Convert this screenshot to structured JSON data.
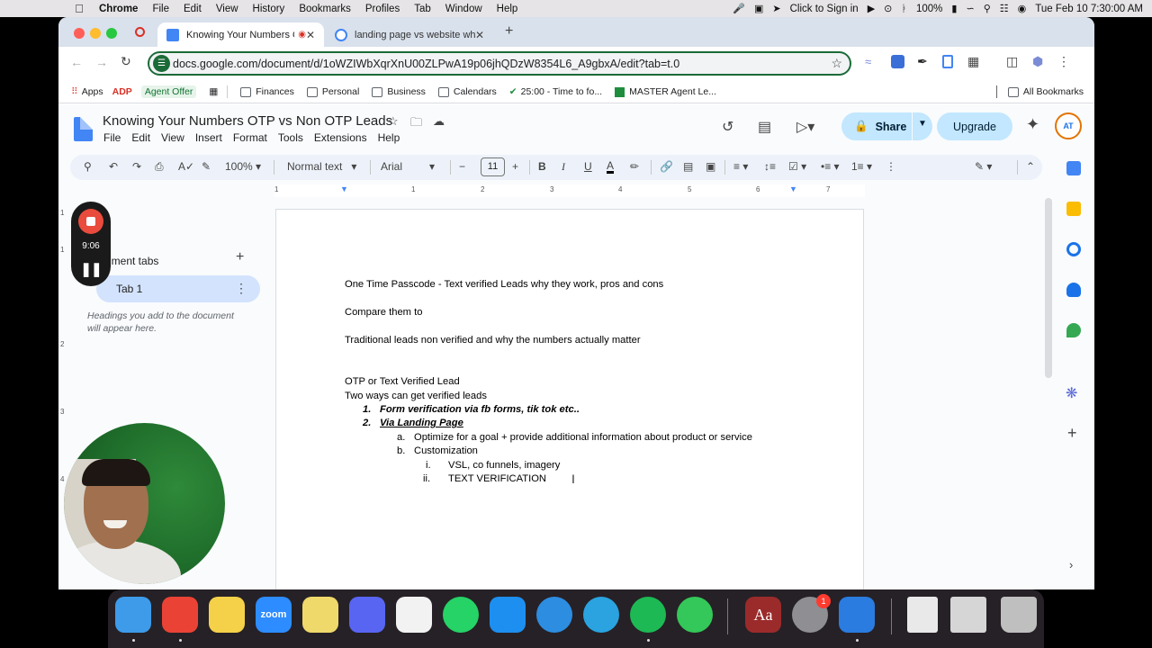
{
  "menubar": {
    "app": "Chrome",
    "items": [
      "File",
      "Edit",
      "View",
      "History",
      "Bookmarks",
      "Profiles",
      "Tab",
      "Window",
      "Help"
    ],
    "sign_in": "Click to Sign in",
    "battery": "100%",
    "clock": "Tue Feb 10  7:30:00 AM"
  },
  "browser": {
    "tabs": [
      {
        "title": "Knowing Your Numbers O",
        "active": true
      },
      {
        "title": "landing page vs website what",
        "active": false
      }
    ],
    "url": "docs.google.com/document/d/1oWZIWbXqrXnU00ZLPwA19p06jhQDzW8354L6_A9gbxA/edit?tab=t.0",
    "bookmarks": [
      "Apps",
      "ADP",
      "Agent Offer",
      "Finances",
      "Personal",
      "Business",
      "Calendars",
      "25:00 - Time to fo...",
      "MASTER Agent Le..."
    ],
    "all_bookmarks": "All Bookmarks"
  },
  "docs": {
    "title": "Knowing Your Numbers OTP vs Non OTP Leads",
    "menu": [
      "File",
      "Edit",
      "View",
      "Insert",
      "Format",
      "Tools",
      "Extensions",
      "Help"
    ],
    "share_label": "Share",
    "upgrade_label": "Upgrade",
    "avatar_initials": "AT",
    "zoom": "100%",
    "style": "Normal text",
    "font": "Arial",
    "font_size": "11",
    "ruler_numbers": [
      "1",
      "1",
      "2",
      "3",
      "4",
      "5",
      "6",
      "7"
    ],
    "left_ruler_numbers": [
      "1",
      "1",
      "2",
      "3",
      "4"
    ],
    "sidebar": {
      "doc_tabs_label": "ument tabs",
      "add": "+",
      "tab_label": "Tab 1",
      "hint": "Headings you add to the document will appear here."
    },
    "content": {
      "line1": "One Time Passcode - Text verified Leads why they work, pros and cons",
      "line2": "Compare them to",
      "line3": "Traditional leads non verified and why the numbers actually matter",
      "line4": "OTP or Text Verified Lead",
      "line5": "Two ways can get verified leads",
      "list": [
        {
          "marker": "1.",
          "text": "Form verification via fb forms, tik tok etc.."
        },
        {
          "marker": "2.",
          "text": "Via Landing Page"
        }
      ],
      "sublist": [
        {
          "marker": "a.",
          "text": "Optimize for a goal + provide additional information about product or service"
        },
        {
          "marker": "b.",
          "text": "Customization"
        }
      ],
      "subsublist": [
        {
          "marker": "i.",
          "text": "VSL, co funnels, imagery"
        },
        {
          "marker": "ii.",
          "text": "TEXT VERIFICATION"
        }
      ]
    }
  },
  "recorder": {
    "time": "9:06"
  },
  "dock": {
    "badge": "1",
    "apps": [
      {
        "name": "finder",
        "label": "",
        "color": "#3d9be9"
      },
      {
        "name": "chrome",
        "label": "",
        "color": "#ea4335"
      },
      {
        "name": "notes",
        "label": "",
        "color": "#f5d14a"
      },
      {
        "name": "zoom",
        "label": "zoom",
        "color": "#2d8cff"
      },
      {
        "name": "stickies",
        "label": "",
        "color": "#efd96b"
      },
      {
        "name": "discord",
        "label": "",
        "color": "#5865f2"
      },
      {
        "name": "reminders",
        "label": "",
        "color": "#f2f2f2"
      },
      {
        "name": "whatsapp",
        "label": "",
        "color": "#25d366"
      },
      {
        "name": "app-store",
        "label": "",
        "color": "#1d8ff0"
      },
      {
        "name": "safari",
        "label": "",
        "color": "#2d8de0"
      },
      {
        "name": "telegram",
        "label": "",
        "color": "#2aa3e0"
      },
      {
        "name": "spotify",
        "label": "",
        "color": "#1db954"
      },
      {
        "name": "messages",
        "label": "",
        "color": "#34c759"
      },
      {
        "name": "dictionary",
        "label": "Aa",
        "color": "#9b2b2b"
      },
      {
        "name": "system-settings",
        "label": "",
        "color": "#8e8e93"
      },
      {
        "name": "downloads",
        "label": "",
        "color": "#2a7ce0"
      },
      {
        "name": "document",
        "label": "",
        "color": "#e9e9e9"
      },
      {
        "name": "preview",
        "label": "",
        "color": "#d6d6d6"
      },
      {
        "name": "trash",
        "label": "",
        "color": "#bfbfbf"
      }
    ]
  }
}
